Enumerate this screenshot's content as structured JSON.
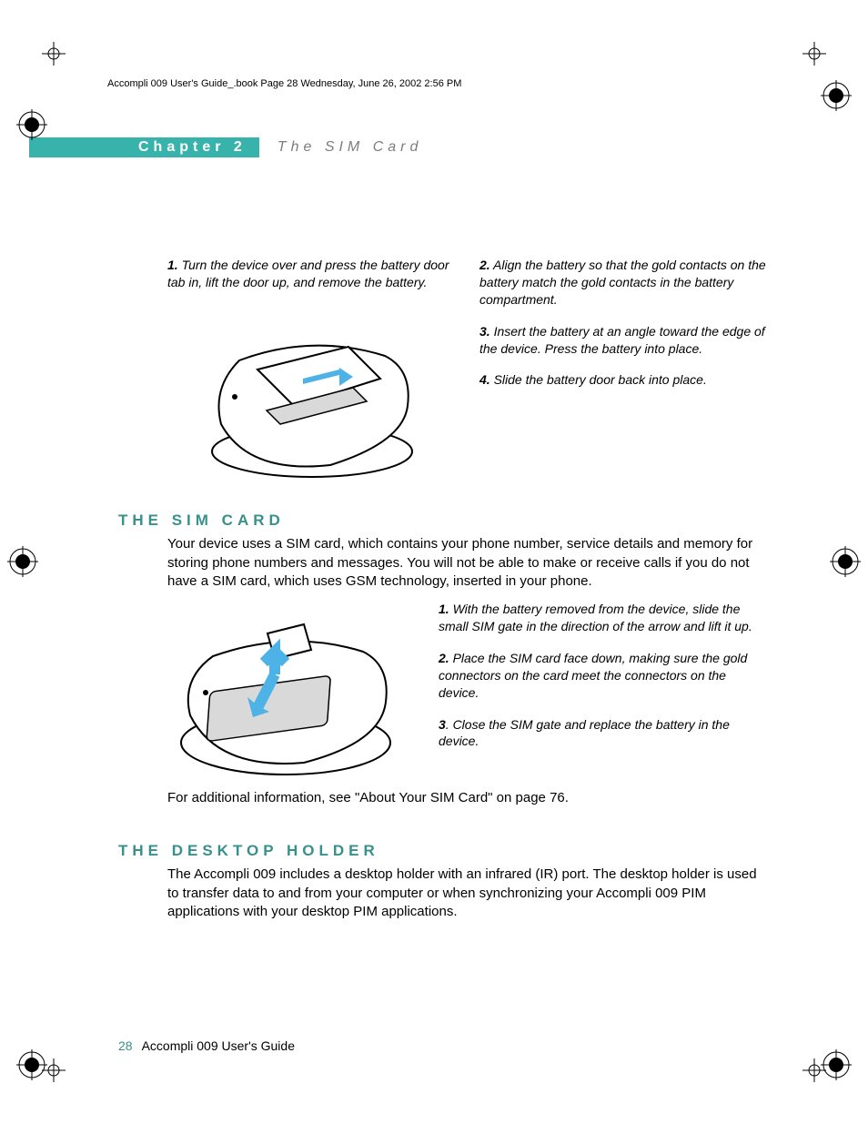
{
  "print_header": "Accompli 009 User's Guide_.book  Page 28  Wednesday, June 26, 2002  2:56 PM",
  "chapter_label": "Chapter 2",
  "chapter_title": "The SIM Card",
  "battery_steps": {
    "s1n": "1.",
    "s1": " Turn the device over and press the battery door tab in, lift the door up, and remove the battery.",
    "s2n": "2.",
    "s2": " Align the battery so that the gold contacts on the battery match the gold contacts in the battery compartment.",
    "s3n": "3.",
    "s3": " Insert the battery at an angle toward the edge of the device.  Press the battery into place.",
    "s4n": "4.",
    "s4": " Slide the battery door back into place."
  },
  "sim_heading": "THE SIM CARD",
  "sim_intro": "Your device uses a SIM card, which contains your phone number, service details and memory for storing phone numbers and messages. You will not be able to make or receive calls if you do not have a SIM card, which uses GSM technology, inserted in your phone.",
  "sim_steps": {
    "s1n": "1.",
    "s1": " With the battery removed from the device, slide the small SIM gate in the direction of the arrow and lift it up.",
    "s2n": "2.",
    "s2": " Place the SIM card face down, making sure the gold connectors on the card meet the connectors on the device.",
    "s3n": "3",
    "s3": ". Close the SIM gate and replace the battery in the device."
  },
  "sim_additional": "For additional information, see \"About Your SIM Card\" on page 76.",
  "desktop_heading": "THE DESKTOP HOLDER",
  "desktop_body": "The Accompli 009 includes a desktop holder with an infrared (IR) port. The desktop holder is used to transfer data to and from your computer or when synchronizing your Accompli 009 PIM applications with your desktop PIM applications.",
  "footer_page": "28",
  "footer_title": "Accompli 009 User's Guide"
}
